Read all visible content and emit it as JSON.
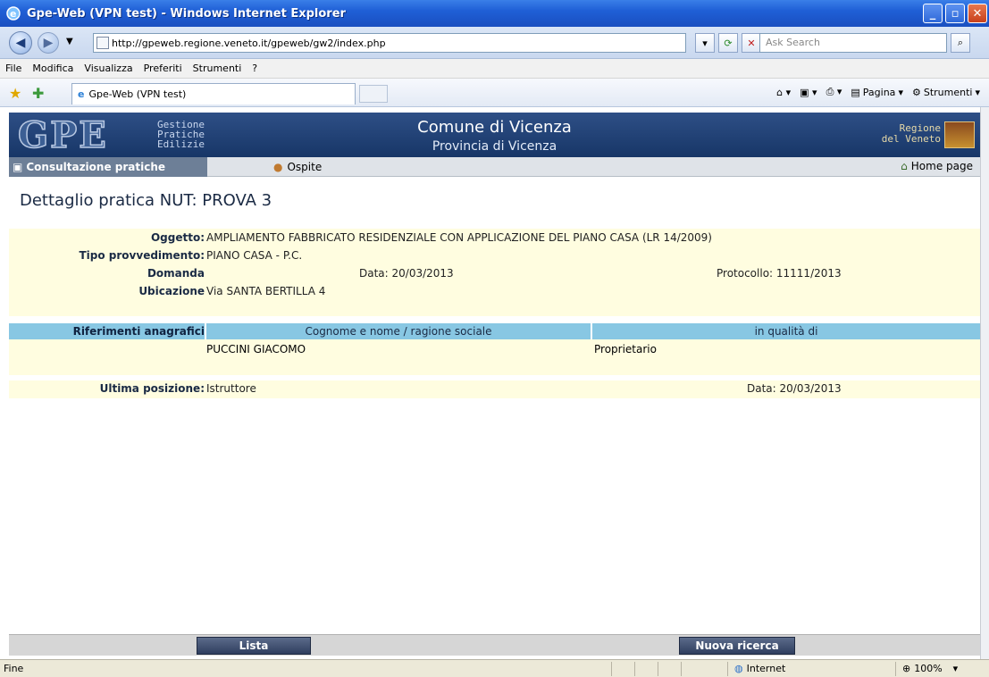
{
  "window": {
    "title": "Gpe-Web (VPN test) - Windows Internet Explorer"
  },
  "addressbar": {
    "url": "http://gpeweb.regione.veneto.it/gpeweb/gw2/index.php",
    "search_placeholder": "Ask Search"
  },
  "menu": {
    "items": [
      "File",
      "Modifica",
      "Visualizza",
      "Preferiti",
      "Strumenti",
      "?"
    ]
  },
  "tabs": {
    "active_label": "Gpe-Web (VPN test)",
    "tools": {
      "pagina": "Pagina",
      "strumenti": "Strumenti"
    }
  },
  "header": {
    "logo": "GPE",
    "logo_sub": [
      "Gestione",
      "Pratiche",
      "Edilizie"
    ],
    "comune": "Comune di Vicenza",
    "provincia": "Provincia di Vicenza",
    "regione": [
      "Regione",
      "del Veneto"
    ]
  },
  "nav": {
    "section": "Consultazione pratiche",
    "user": "Ospite",
    "home": "Home page"
  },
  "page": {
    "title": "Dettaglio pratica NUT: PROVA 3"
  },
  "details": {
    "oggetto_label": "Oggetto:",
    "oggetto_value": "AMPLIAMENTO FABBRICATO RESIDENZIALE CON APPLICAZIONE DEL PIANO CASA (LR 14/2009)",
    "tipo_label": "Tipo provvedimento:",
    "tipo_value": "PIANO CASA - P.C.",
    "domanda_label": "Domanda",
    "domanda_data": "Data: 20/03/2013",
    "domanda_protocollo": "Protocollo: 11111/2013",
    "ubicazione_label": "Ubicazione",
    "ubicazione_value": "Via SANTA BERTILLA 4"
  },
  "riferimenti": {
    "header_label": "Riferimenti anagrafici",
    "col_nome": "Cognome e nome / ragione sociale",
    "col_qualita": "in qualità di",
    "rows": [
      {
        "nome": "PUCCINI GIACOMO",
        "qualita": "Proprietario"
      }
    ]
  },
  "ultima_posizione": {
    "label": "Ultima posizione:",
    "value": "Istruttore",
    "data": "Data: 20/03/2013"
  },
  "buttons": {
    "lista": "Lista",
    "nuova_ricerca": "Nuova ricerca"
  },
  "status": {
    "text": "Fine",
    "zone": "Internet",
    "zoom": "100%"
  }
}
